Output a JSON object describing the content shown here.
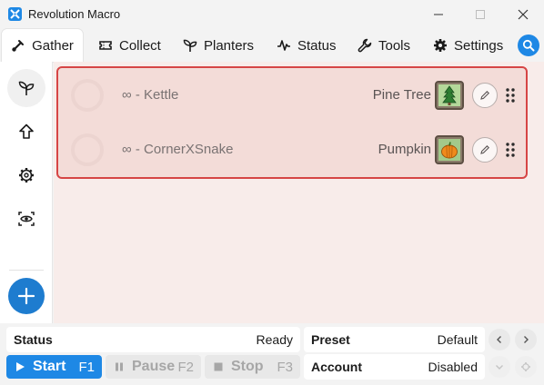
{
  "window": {
    "title": "Revolution Macro"
  },
  "tabs": [
    {
      "label": "Gather",
      "icon": "gather-icon",
      "active": true
    },
    {
      "label": "Collect",
      "icon": "ticket-icon",
      "active": false
    },
    {
      "label": "Planters",
      "icon": "sprout-icon",
      "active": false
    },
    {
      "label": "Status",
      "icon": "pulse-icon",
      "active": false
    },
    {
      "label": "Tools",
      "icon": "wrench-icon",
      "active": false
    },
    {
      "label": "Settings",
      "icon": "gear-icon",
      "active": false
    }
  ],
  "sidebar": {
    "items": [
      {
        "icon": "sprout-icon",
        "active": true
      },
      {
        "icon": "arrow-up-icon",
        "active": false
      },
      {
        "icon": "gear-icon",
        "active": false
      },
      {
        "icon": "eye-scan-icon",
        "active": false
      }
    ],
    "add_icon": "plus-icon"
  },
  "gather_list": [
    {
      "name": "∞ - Kettle",
      "field": "Pine Tree",
      "field_icon": "pine-tree-icon"
    },
    {
      "name": "∞ - CornerXSnake",
      "field": "Pumpkin",
      "field_icon": "pumpkin-icon"
    }
  ],
  "status_bar": {
    "status_label": "Status",
    "status_value": "Ready",
    "preset_label": "Preset",
    "preset_value": "Default",
    "account_label": "Account",
    "account_value": "Disabled"
  },
  "controls": {
    "start_label": "Start",
    "start_key": "F1",
    "pause_label": "Pause",
    "pause_key": "F2",
    "stop_label": "Stop",
    "stop_key": "F3"
  },
  "colors": {
    "accent": "#1e88e5",
    "selection_border": "#d64545",
    "row_background": "#f3dcd8",
    "panel_background": "#f8ecea"
  }
}
